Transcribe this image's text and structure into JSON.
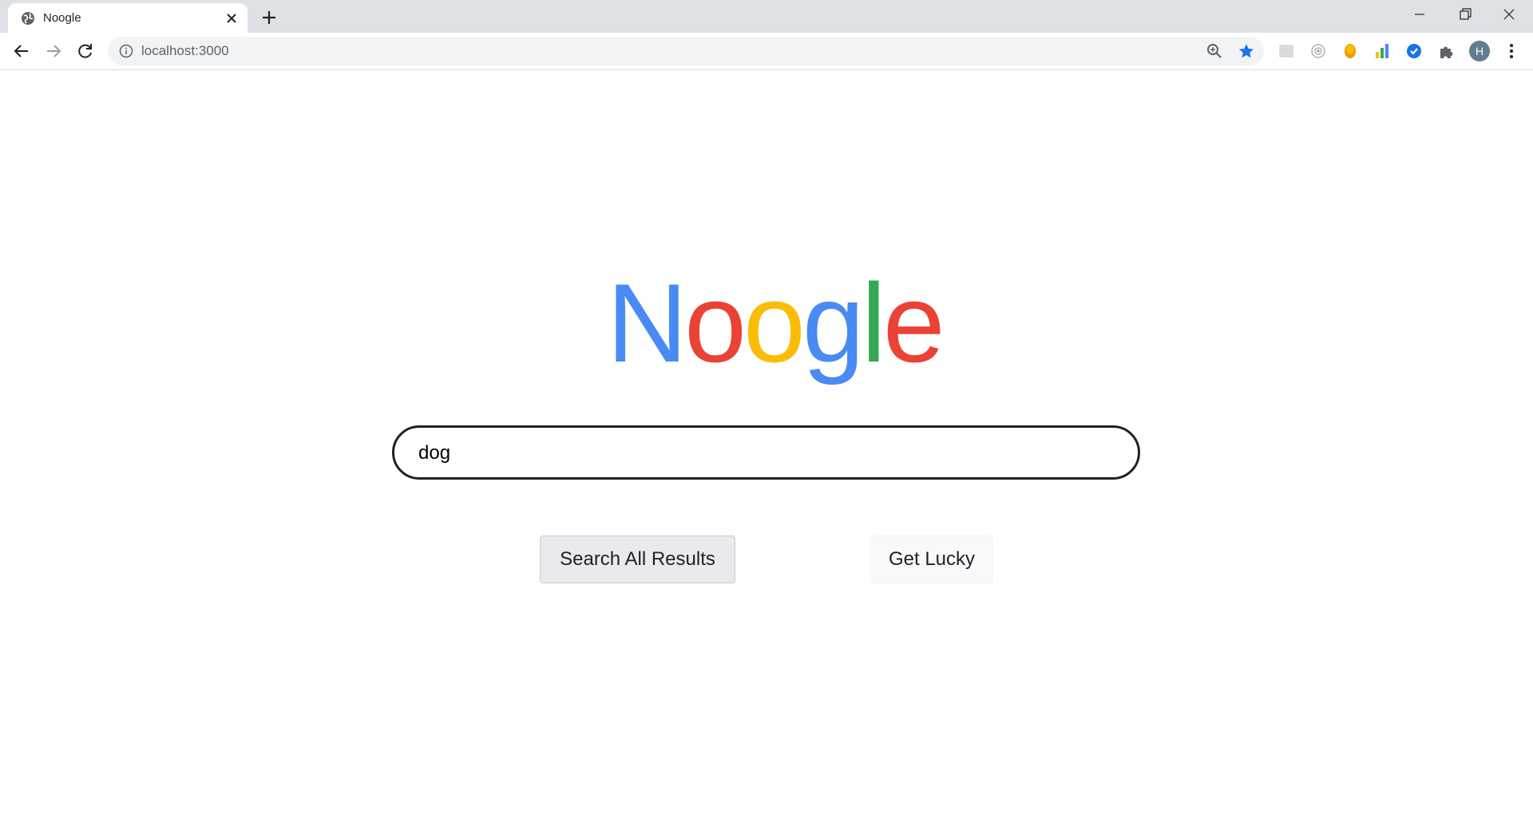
{
  "browser": {
    "tab": {
      "title": "Noogle",
      "favicon": "globe-icon"
    },
    "address_bar": {
      "url": "localhost:3000"
    },
    "profile_initial": "H"
  },
  "logo": {
    "letters": [
      {
        "char": "N",
        "color": "#4a8af4"
      },
      {
        "char": "o",
        "color": "#ea4335"
      },
      {
        "char": "o",
        "color": "#fbbc05"
      },
      {
        "char": "g",
        "color": "#4a8af4"
      },
      {
        "char": "l",
        "color": "#34a853"
      },
      {
        "char": "e",
        "color": "#ea4335"
      }
    ]
  },
  "search": {
    "value": "dog"
  },
  "buttons": {
    "search_all": "Search All Results",
    "lucky": "Get Lucky"
  }
}
